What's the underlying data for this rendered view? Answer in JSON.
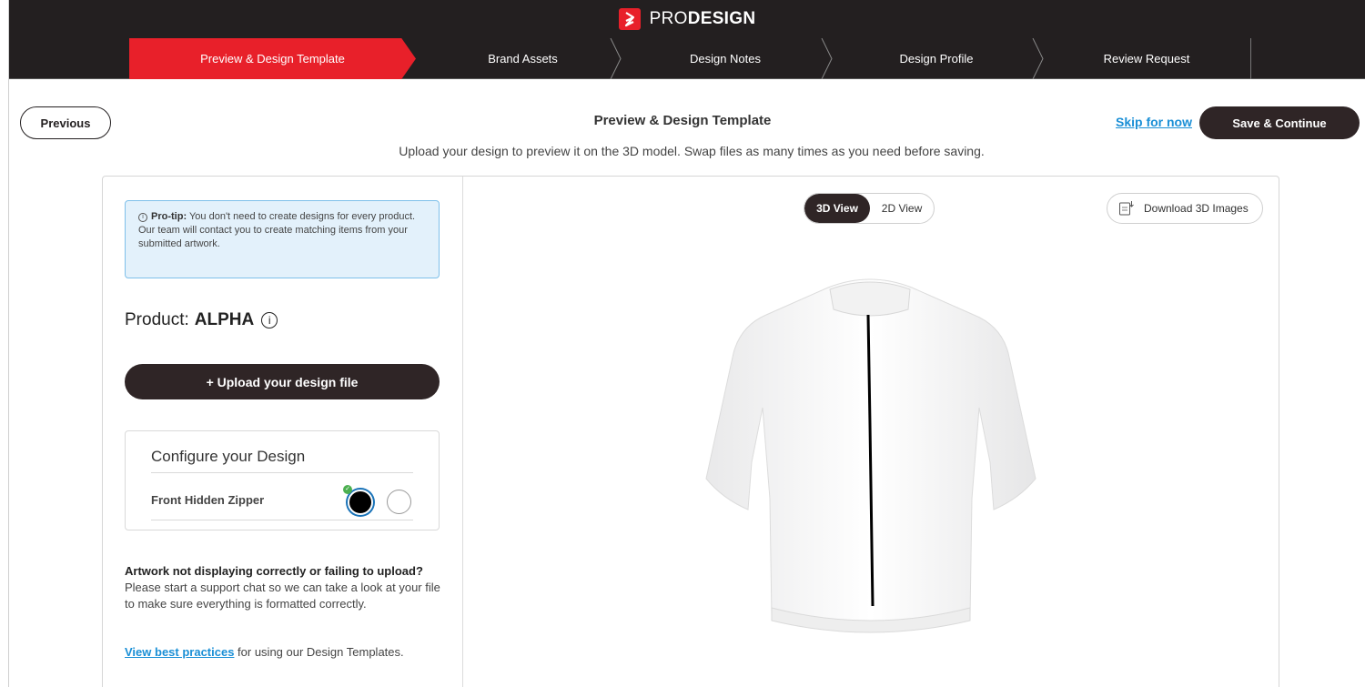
{
  "brand": {
    "prefix": "PRO",
    "suffix": "DESIGN"
  },
  "steps": [
    {
      "label": "Preview & Design Template",
      "active": true
    },
    {
      "label": "Brand Assets",
      "active": false
    },
    {
      "label": "Design Notes",
      "active": false
    },
    {
      "label": "Design Profile",
      "active": false
    },
    {
      "label": "Review Request",
      "active": false
    }
  ],
  "header": {
    "previous_label": "Previous",
    "title": "Preview & Design Template",
    "subtitle": "Upload your design to preview it on the 3D model. Swap files as many times as you need before saving.",
    "skip_label": "Skip for now",
    "save_label": "Save & Continue"
  },
  "sidebar": {
    "tip_heading": "Pro-tip:",
    "tip_text": "You don't need to create designs for every product. Our team will contact you to create matching items from your submitted artwork.",
    "product_label": "Product:",
    "product_name": "ALPHA",
    "upload_label": "+ Upload your design file",
    "config_title": "Configure your Design",
    "config_option_label": "Front Hidden Zipper",
    "zipper_colors": [
      "#000000",
      "#ffffff"
    ],
    "help_heading": "Artwork not displaying correctly or failing to upload?",
    "help_text": "Please start a support chat so we can take a look at your file to make sure everything is formatted correctly.",
    "best_link": "View best practices",
    "best_suffix": " for using our Design Templates."
  },
  "viewer": {
    "view_3d": "3D View",
    "view_2d": "2D View",
    "active_view": "3D View",
    "download_label": "Download 3D Images"
  },
  "colors": {
    "accent": "#e8202a",
    "dark": "#231f20",
    "button": "#2f2526",
    "link": "#1a8fd6"
  },
  "icons": [
    "logo-icon",
    "info-icon",
    "check-icon",
    "download-icon"
  ]
}
